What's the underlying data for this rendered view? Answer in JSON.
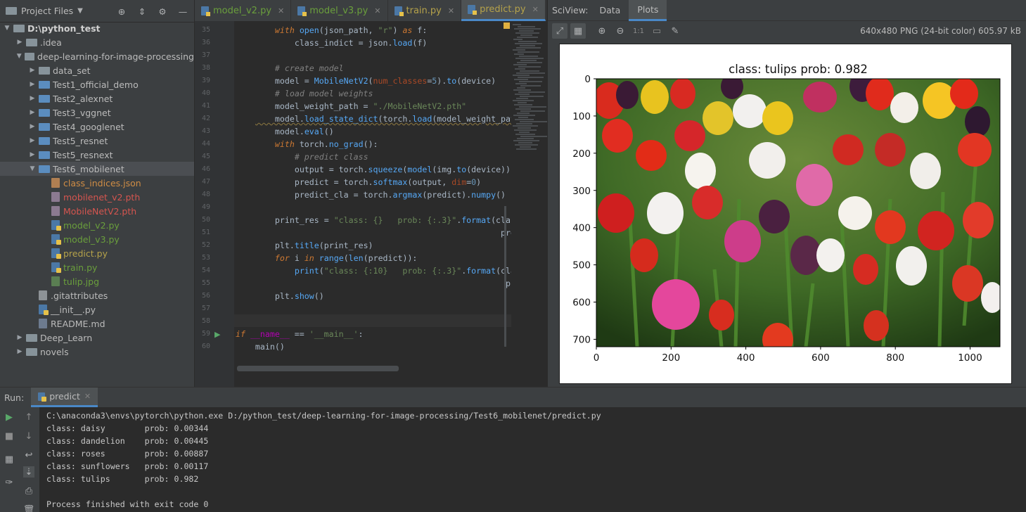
{
  "project": {
    "title": "Project Files",
    "tree": [
      {
        "label": "D:\\python_test",
        "indent": 0,
        "type": "folder",
        "open": true,
        "color": "bold"
      },
      {
        "label": ".idea",
        "indent": 1,
        "type": "folder",
        "open": false,
        "color": "white"
      },
      {
        "label": "deep-learning-for-image-processing",
        "indent": 1,
        "type": "folder",
        "open": true,
        "color": "white"
      },
      {
        "label": "data_set",
        "indent": 2,
        "type": "folder",
        "open": false,
        "color": "white"
      },
      {
        "label": "Test1_official_demo",
        "indent": 2,
        "type": "folder-blue",
        "open": false,
        "color": "white"
      },
      {
        "label": "Test2_alexnet",
        "indent": 2,
        "type": "folder-blue",
        "open": false,
        "color": "white"
      },
      {
        "label": "Test3_vggnet",
        "indent": 2,
        "type": "folder-blue",
        "open": false,
        "color": "white"
      },
      {
        "label": "Test4_googlenet",
        "indent": 2,
        "type": "folder-blue",
        "open": false,
        "color": "white"
      },
      {
        "label": "Test5_resnet",
        "indent": 2,
        "type": "folder-blue",
        "open": false,
        "color": "white"
      },
      {
        "label": "Test5_resnext",
        "indent": 2,
        "type": "folder-blue",
        "open": false,
        "color": "white"
      },
      {
        "label": "Test6_mobilenet",
        "indent": 2,
        "type": "folder-blue",
        "open": true,
        "color": "white",
        "selected": true
      },
      {
        "label": "class_indices.json",
        "indent": 3,
        "type": "json",
        "color": "orange"
      },
      {
        "label": "mobilenet_v2.pth",
        "indent": 3,
        "type": "pth",
        "color": "red"
      },
      {
        "label": "MobileNetV2.pth",
        "indent": 3,
        "type": "pth",
        "color": "red"
      },
      {
        "label": "model_v2.py",
        "indent": 3,
        "type": "py",
        "color": "green"
      },
      {
        "label": "model_v3.py",
        "indent": 3,
        "type": "py",
        "color": "green"
      },
      {
        "label": "predict.py",
        "indent": 3,
        "type": "py",
        "color": "yellow"
      },
      {
        "label": "train.py",
        "indent": 3,
        "type": "py",
        "color": "green"
      },
      {
        "label": "tulip.jpg",
        "indent": 3,
        "type": "img",
        "color": "green"
      },
      {
        "label": ".gitattributes",
        "indent": 2,
        "type": "txt",
        "color": "white"
      },
      {
        "label": "__init__.py",
        "indent": 2,
        "type": "py",
        "color": "white"
      },
      {
        "label": "README.md",
        "indent": 2,
        "type": "md",
        "color": "white"
      },
      {
        "label": "Deep_Learn",
        "indent": 1,
        "type": "folder",
        "open": false,
        "color": "white"
      },
      {
        "label": "novels",
        "indent": 1,
        "type": "folder",
        "open": false,
        "color": "white"
      }
    ]
  },
  "editor": {
    "tabs": [
      {
        "label": "model_v2.py",
        "color": "#6a9f3c",
        "active": false
      },
      {
        "label": "model_v3.py",
        "color": "#6a9f3c",
        "active": false
      },
      {
        "label": "train.py",
        "color": "#b5a24a",
        "active": false
      },
      {
        "label": "predict.py",
        "color": "#b5a24a",
        "active": true
      }
    ],
    "line_numbers": [
      "35",
      "36",
      "37",
      "38",
      "39",
      "40",
      "41",
      "42",
      "43",
      "44",
      "45",
      "46",
      "47",
      "48",
      "49",
      "50",
      "51",
      "52",
      "53",
      "54",
      "55",
      "56",
      "57",
      "58",
      "59",
      "60"
    ]
  },
  "sciview": {
    "title": "SciView:",
    "tabs": [
      "Data",
      "Plots"
    ],
    "active_tab": "Plots",
    "image_info": "640x480 PNG (24-bit color) 605.97 kB",
    "toolbar_zoom_label": "1:1"
  },
  "chart_data": {
    "type": "image",
    "title": "class: tulips   prob: 0.982",
    "x_ticks": [
      "0",
      "200",
      "400",
      "600",
      "800",
      "1000"
    ],
    "y_ticks": [
      "0",
      "100",
      "200",
      "300",
      "400",
      "500",
      "600",
      "700"
    ],
    "xlim": [
      0,
      1080
    ],
    "ylim": [
      720,
      0
    ]
  },
  "run": {
    "label": "Run:",
    "tab": "predict",
    "output": [
      "C:\\anaconda3\\envs\\pytorch\\python.exe D:/python_test/deep-learning-for-image-processing/Test6_mobilenet/predict.py",
      "class: daisy        prob: 0.00344",
      "class: dandelion    prob: 0.00445",
      "class: roses        prob: 0.00887",
      "class: sunflowers   prob: 0.00117",
      "class: tulips       prob: 0.982",
      "",
      "Process finished with exit code 0"
    ]
  }
}
